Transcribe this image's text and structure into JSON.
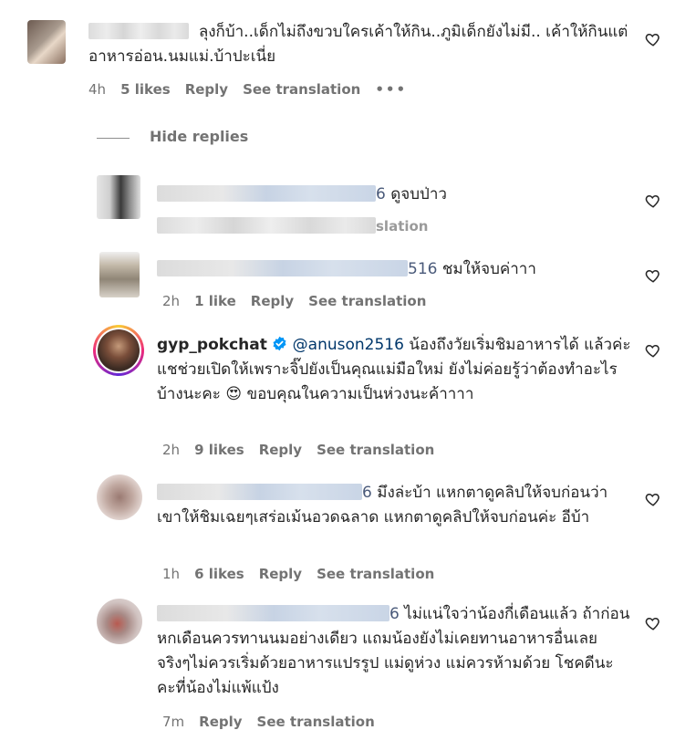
{
  "comments": [
    {
      "text": "ลุงก็บ้า..เด็กไม่ถึงขวบใครเค้าให้กิน..ภูมิเด็กยังไม่มี.. เค้าให้กินแต่อาหารอ่อน.นมแม่.บ้าปะเนี่ย",
      "time": "4h",
      "likes": "5 likes",
      "reply": "Reply",
      "translate": "See translation",
      "more": "•••"
    },
    {
      "suffix": "6",
      "text": "ดูจบป่าว",
      "line2_suffix": "slation"
    },
    {
      "suffix": "516",
      "text": "ชมให้จบค่าาา",
      "time": "2h",
      "likes": "1 like",
      "reply": "Reply",
      "translate": "See translation"
    },
    {
      "username": "gyp_pokchat",
      "mention": "@anuson2516",
      "text_line1": "น้องถึงวัยเริ่มชิมอาหารได้",
      "text_rest": "แล้วค่ะ แชช่วยเปิดให้เพราะจิ๊ปยังเป็นคุณแม่มือใหม่ ยังไม่ค่อยรู้ว่าต้องทำอะไรบ้างนะคะ",
      "emoji": "😍",
      "text_end": " ขอบคุณในความเป็นห่วงนะค้าาาา",
      "time": "2h",
      "likes": "9 likes",
      "reply": "Reply",
      "translate": "See translation"
    },
    {
      "suffix": "6",
      "text": "มึงล่ะบ้า แหกตาดูคลิปให้จบก่อนว่าเขาให้ชิมเฉยๆเสร่อเม้นอวดฉลาด แหกตาดูคลิปให้จบก่อนค่ะ อีบ้า",
      "time": "1h",
      "likes": "6 likes",
      "reply": "Reply",
      "translate": "See translation"
    },
    {
      "suffix": "6",
      "text": "ไม่แน่ใจว่าน้องกี่เดือนแล้ว ถ้าก่อนหกเดือนควรทานนมอย่างเดียว แถมน้องยังไม่เคยทานอาหารอื่นเลย จริงๆไม่ควรเริ่มด้วยอาหารแปรรูป แม่ดูห่วง แม่ควรห้ามด้วย โชคดีนะคะที่น้องไม่แพ้แป้ง",
      "time": "7m",
      "reply": "Reply",
      "translate": "See translation"
    }
  ],
  "hide_replies": "Hide replies",
  "icons": {
    "like": "heart-outline-icon",
    "verified": "verified-badge-icon"
  },
  "colors": {
    "text": "#262626",
    "meta": "#737373",
    "mention": "#00376b",
    "verified": "#0095f6"
  }
}
